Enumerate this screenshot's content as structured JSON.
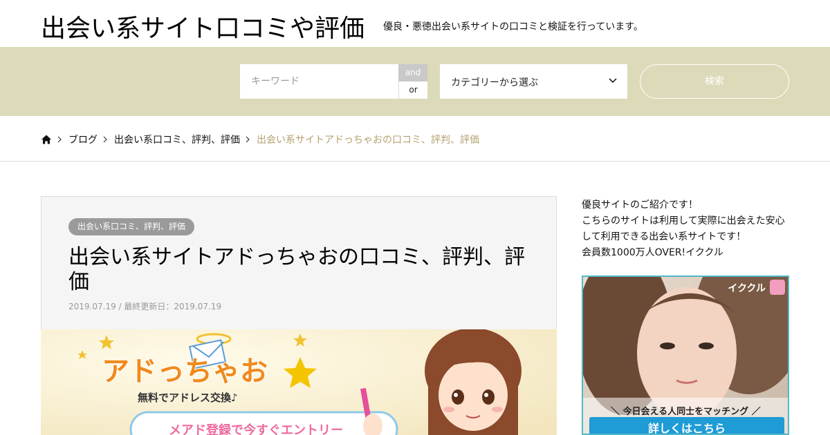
{
  "header": {
    "site_title": "出会い系サイト口コミや評価",
    "site_description": "優良・悪徳出会い系サイトの口コミと検証を行っています。"
  },
  "search": {
    "keyword_placeholder": "キーワード",
    "and_label": "and",
    "or_label": "or",
    "category_label": "カテゴリーから選ぶ",
    "submit_label": "検索"
  },
  "breadcrumb": {
    "items": [
      "ブログ",
      "出会い系口コミ、評判、評価"
    ],
    "current": "出会い系サイトアドっちゃおの口コミ、評判、評価"
  },
  "post": {
    "category": "出会い系口コミ、評判、評価",
    "title": "出会い系サイトアドっちゃおの口コミ、評判、評価",
    "meta": "2019.07.19 / 最終更新日：2019.07.19",
    "hero": {
      "logo_text": "アドっちゃお",
      "tagline": "無料でアドレス交換♪",
      "cta_text": "メアド登録で今すぐエントリー"
    }
  },
  "sidebar": {
    "lines": [
      "優良サイトのご紹介です！",
      "こちらのサイトは利用して実際に出会えた安心",
      "して利用できる出会い系サイトです！",
      "会員数1000万人OVER!イククル"
    ],
    "ad": {
      "brand": "イククル",
      "tagline": "＼ 今日会える人同士をマッチング ／",
      "cta": "詳しくはこちら"
    }
  },
  "colors": {
    "search_band": "#dcdab8",
    "breadcrumb_current": "#b5a06f",
    "badge": "#9a9a9a",
    "ad_cta": "#1f9bd6"
  }
}
